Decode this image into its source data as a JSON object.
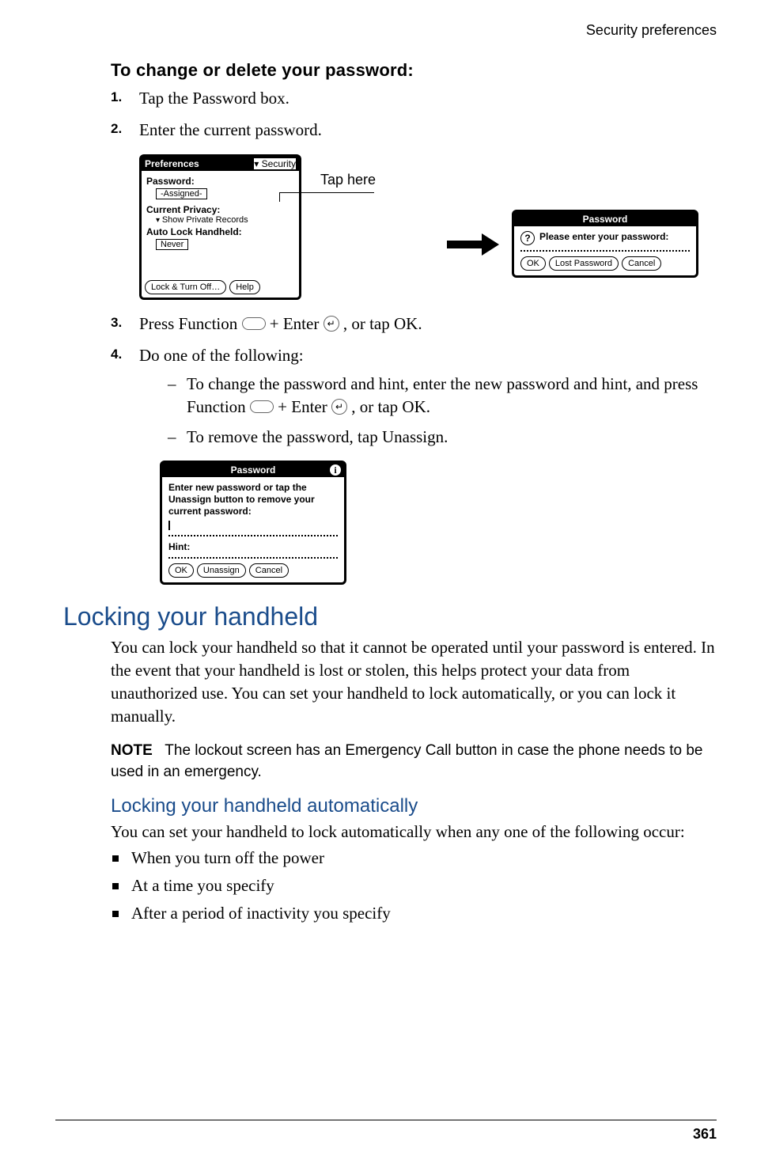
{
  "running_head": "Security preferences",
  "page_number": "361",
  "procedure_title": "To change or delete your password:",
  "steps": {
    "s1": {
      "num": "1.",
      "text": "Tap the Password box."
    },
    "s2": {
      "num": "2.",
      "text": "Enter the current password."
    },
    "s3_num": "3.",
    "s3_a": "Press Function ",
    "s3_b": " + Enter ",
    "s3_c": ", or tap OK.",
    "s4": {
      "num": "4.",
      "text": "Do one of the following:"
    }
  },
  "sub_a1": "To change the password and hint, enter the new password and hint, and press Function ",
  "sub_a2": " + Enter ",
  "sub_a3": ", or tap OK.",
  "sub_b": "To remove the password, tap Unassign.",
  "callout": "Tap here",
  "fig1": {
    "title": "Preferences",
    "category": "Security",
    "password_label": "Password:",
    "password_value": "-Assigned-",
    "privacy_label": "Current Privacy:",
    "privacy_value": "Show Private Records",
    "autolock_label": "Auto Lock Handheld:",
    "autolock_value": "Never",
    "btn_lock": "Lock & Turn Off…",
    "btn_help": "Help"
  },
  "dlg1": {
    "title": "Password",
    "msg": "Please enter your password:",
    "ok": "OK",
    "lost": "Lost Password",
    "cancel": "Cancel"
  },
  "dlg2": {
    "title": "Password",
    "msg": "Enter new password or tap the Unassign button to remove your current password:",
    "hint_label": "Hint:",
    "ok": "OK",
    "unassign": "Unassign",
    "cancel": "Cancel"
  },
  "h2": "Locking your handheld",
  "para1": "You can lock your handheld so that it cannot be operated until your password is entered. In the event that your handheld is lost or stolen, this helps protect your data from unauthorized use. You can set your handheld to lock automatically, or you can lock it manually.",
  "note_label": "NOTE",
  "note_text": "The lockout screen has an Emergency Call button in case the phone needs to be used in an emergency.",
  "h3": "Locking your handheld automatically",
  "para2": "You can set your handheld to lock automatically when any one of the following occur:",
  "bullets": {
    "b1": "When you turn off the power",
    "b2": "At a time you specify",
    "b3": "After a period of inactivity you specify"
  }
}
